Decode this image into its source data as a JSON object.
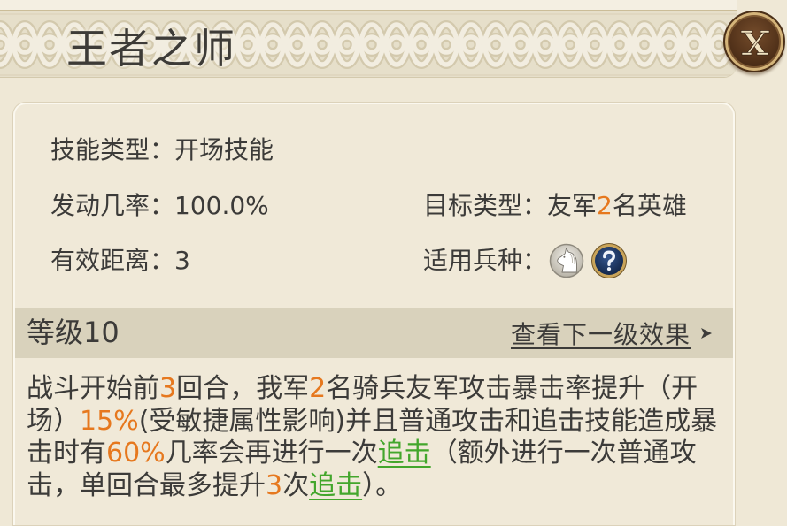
{
  "dialog": {
    "title": "王者之师",
    "close_icon": "close-icon"
  },
  "skill_info": {
    "skill_type": {
      "label": "技能类型：",
      "value": "开场技能"
    },
    "trigger_rate": {
      "label": "发动几率：",
      "value": "100.0%"
    },
    "effective_range": {
      "label": "有效距离：",
      "value": "3"
    },
    "target_type": {
      "label": "目标类型：",
      "value_prefix": "友军",
      "value_count": "2",
      "value_suffix": "名英雄"
    },
    "applicable_troops": {
      "label": "适用兵种：",
      "icons": [
        "cavalry-horse-icon",
        "question-mark-icon"
      ]
    }
  },
  "level": {
    "label": "等级10",
    "next_level_link": "查看下一级效果",
    "next_level_icon": "arrow-right-icon"
  },
  "description": {
    "lines": [
      [
        {
          "text": "战斗开始前"
        },
        {
          "text": "3",
          "highlight": true
        },
        {
          "text": "回合，我军"
        },
        {
          "text": "2",
          "highlight": true
        },
        {
          "text": "名骑兵友军攻击暴击率提升（开"
        }
      ],
      [
        {
          "text": "场）"
        },
        {
          "text": "15%",
          "highlight": true
        },
        {
          "text": "(受敏捷属性影响)并且普通攻击和追击技能造成暴"
        }
      ],
      [
        {
          "text": "击时有"
        },
        {
          "text": "60%",
          "highlight": true
        },
        {
          "text": "几率会再进行一次"
        },
        {
          "text": "追击",
          "link": true
        },
        {
          "text": "（额外进行一次普通攻"
        }
      ],
      [
        {
          "text": "击，单回合最多提升"
        },
        {
          "text": "3",
          "highlight": true
        },
        {
          "text": "次"
        },
        {
          "text": "追击",
          "link": true
        },
        {
          "text": "）。"
        }
      ]
    ]
  },
  "colors": {
    "text": "#3c3b39",
    "highlight": "#e6781e",
    "link": "#43a62c",
    "background": "#efe8d6",
    "panel": "#f0e9d8",
    "level_bar": "#d9d2bc"
  }
}
